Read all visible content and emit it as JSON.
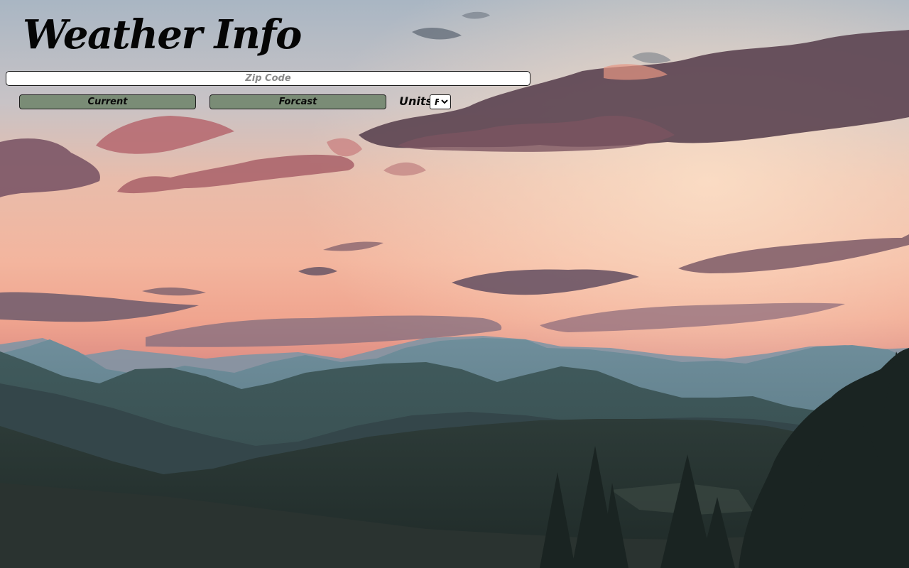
{
  "app": {
    "title": "Weather Info"
  },
  "search": {
    "value": "",
    "placeholder": "Zip Code"
  },
  "actions": {
    "current_label": "Current",
    "forecast_label": "Forcast"
  },
  "units": {
    "label": "Units:",
    "selected": "F",
    "options": [
      "F"
    ]
  },
  "theme": {
    "button_color": "#7a8c76",
    "sky_top": "#aab8c6",
    "sky_glow": "#f3b59e",
    "mountain_far": "#5d7b88",
    "mountain_near": "#2b3a37"
  },
  "background": {
    "icon": "sunset-mountain-landscape"
  }
}
